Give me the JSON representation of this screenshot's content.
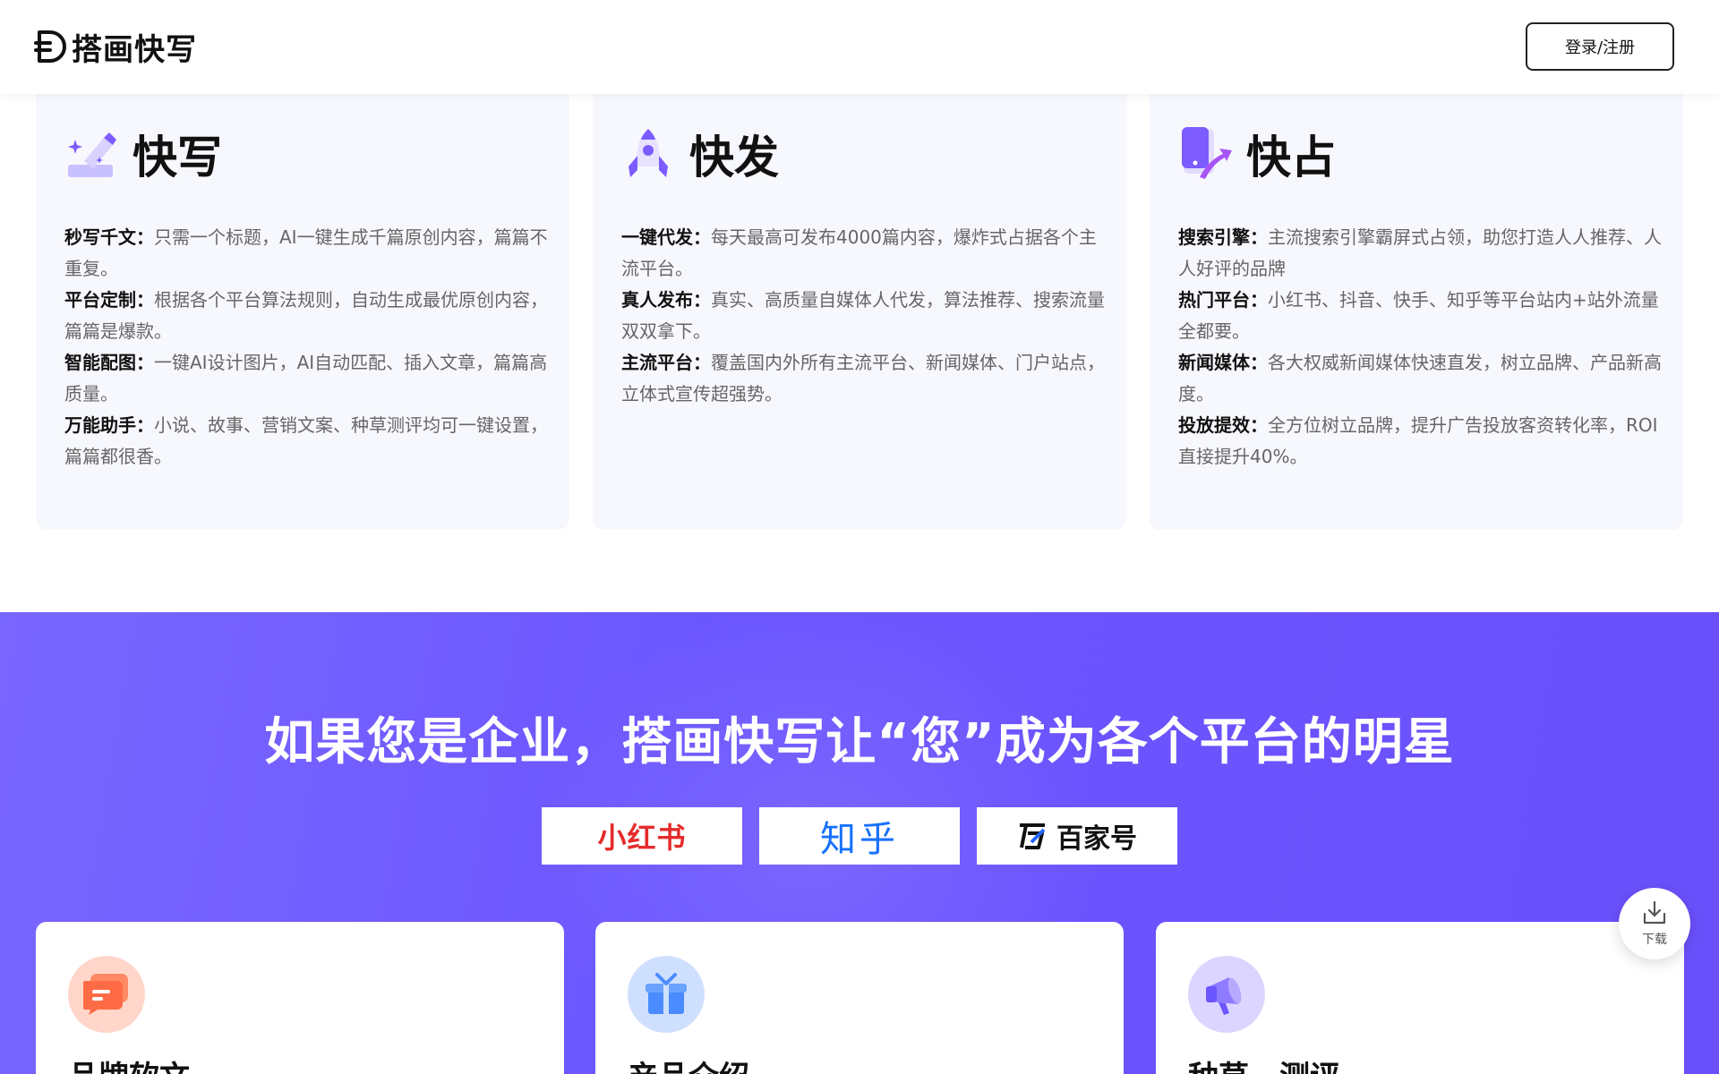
{
  "header": {
    "brand": "搭画快写",
    "login_label": "登录/注册"
  },
  "features": [
    {
      "title": "快写",
      "icon": "pen-sparkle-icon",
      "items": [
        {
          "key": "秒写千文：",
          "text": "只需一个标题，AI一键生成千篇原创内容，篇篇不重复。"
        },
        {
          "key": "平台定制：",
          "text": "根据各个平台算法规则，自动生成最优原创内容，篇篇是爆款。"
        },
        {
          "key": "智能配图：",
          "text": "一键AI设计图片，AI自动匹配、插入文章，篇篇高质量。"
        },
        {
          "key": "万能助手：",
          "text": "小说、故事、营销文案、种草测评均可一键设置，篇篇都很香。"
        }
      ]
    },
    {
      "title": "快发",
      "icon": "rocket-icon",
      "items": [
        {
          "key": "一键代发：",
          "text": "每天最高可发布4000篇内容，爆炸式占据各个主流平台。"
        },
        {
          "key": "真人发布：",
          "text": "真实、高质量自媒体人代发，算法推荐、搜索流量双双拿下。"
        },
        {
          "key": "主流平台：",
          "text": "覆盖国内外所有主流平台、新闻媒体、门户站点，立体式宣传超强势。"
        }
      ]
    },
    {
      "title": "快占",
      "icon": "phone-arrow-icon",
      "items": [
        {
          "key": "搜索引擎：",
          "text": "主流搜索引擎霸屏式占领，助您打造人人推荐、人人好评的品牌"
        },
        {
          "key": "热门平台：",
          "text": "小红书、抖音、快手、知乎等平台站内+站外流量全都要。"
        },
        {
          "key": "新闻媒体：",
          "text": "各大权威新闻媒体快速直发，树立品牌、产品新高度。"
        },
        {
          "key": "投放提效：",
          "text": "全方位树立品牌，提升广告投放客资转化率，ROI直接提升40%。"
        }
      ]
    }
  ],
  "promo": {
    "title": "如果您是企业，搭画快写让“您”成为各个平台的明星",
    "platforms": [
      "小红书",
      "知乎",
      "百家号"
    ]
  },
  "scenes": [
    {
      "title": "品牌软文",
      "icon": "chat-bubble-icon",
      "color": "#ff8a65"
    },
    {
      "title": "产品介绍",
      "icon": "gift-icon",
      "color": "#4a8cff"
    },
    {
      "title": "种草、测评",
      "icon": "megaphone-icon",
      "color": "#8f7bff"
    }
  ],
  "float": {
    "download_label": "下载"
  },
  "colors": {
    "purple": "#6c56ff",
    "card_bg": "#f7f8fd"
  }
}
